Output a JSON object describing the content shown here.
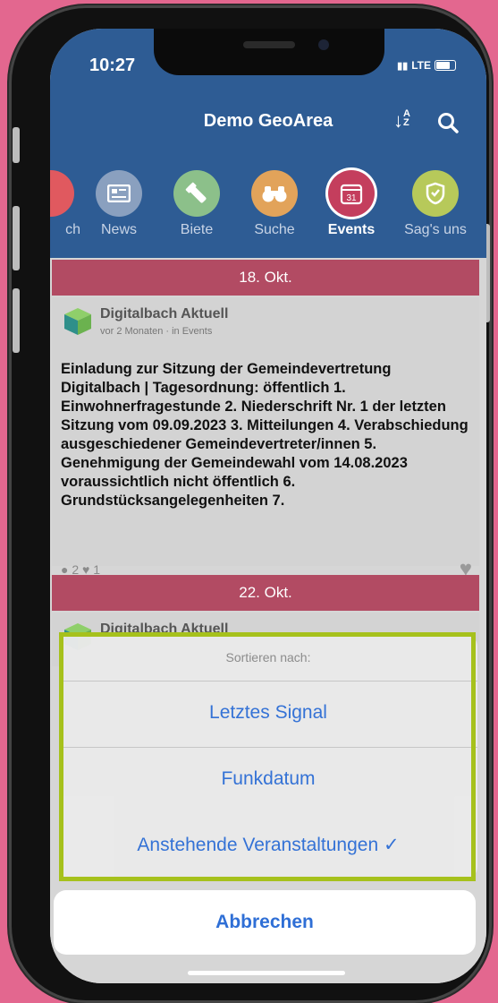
{
  "status": {
    "time": "10:27",
    "network": "LTE"
  },
  "header": {
    "title": "Demo GeoArea"
  },
  "categories": [
    {
      "label": "ch",
      "icon": "partial-icon",
      "color": "#e0595f"
    },
    {
      "label": "News",
      "icon": "newspaper-icon",
      "color": "#8aa0bf"
    },
    {
      "label": "Biete",
      "icon": "flashlight-icon",
      "color": "#8cc08a"
    },
    {
      "label": "Suche",
      "icon": "binoculars-icon",
      "color": "#e2a35a"
    },
    {
      "label": "Events",
      "icon": "calendar-icon",
      "color": "#c43e5d",
      "day": "31"
    },
    {
      "label": "Sag's uns",
      "icon": "shield-icon",
      "color": "#b7c95a"
    }
  ],
  "feed": [
    {
      "date": "18. Okt.",
      "author": "Digitalbach Aktuell",
      "meta": "vor 2 Monaten · in Events",
      "text": "Einladung zur Sitzung der Gemeindevertretung Digitalbach | Tagesordnung: öffentlich 1. Einwohnerfragestunde 2. Niederschrift Nr. 1 der letzten Sitzung vom 09.09.2023 3. Mitteilungen 4. Verabschiedung ausgeschiedener Gemeindevertreter/innen 5. Genehmigung der Gemeindewahl vom 14.08.2023 voraussichtlich nicht öffentlich 6. Grundstücksangelegenheiten 7.",
      "comments": "2",
      "likes": "1"
    },
    {
      "date": "22. Okt.",
      "author": "Digitalbach Aktuell"
    }
  ],
  "action_sheet": {
    "title": "Sortieren nach:",
    "options": [
      "Letztes Signal",
      "Funkdatum",
      "Anstehende Veranstaltungen ✓"
    ],
    "cancel": "Abbrechen"
  },
  "colors": {
    "header": "#2e5c94",
    "banner": "#b24b63",
    "action": "#2f6fd6",
    "highlight": "#a6c11c",
    "background": "#e3678f"
  }
}
